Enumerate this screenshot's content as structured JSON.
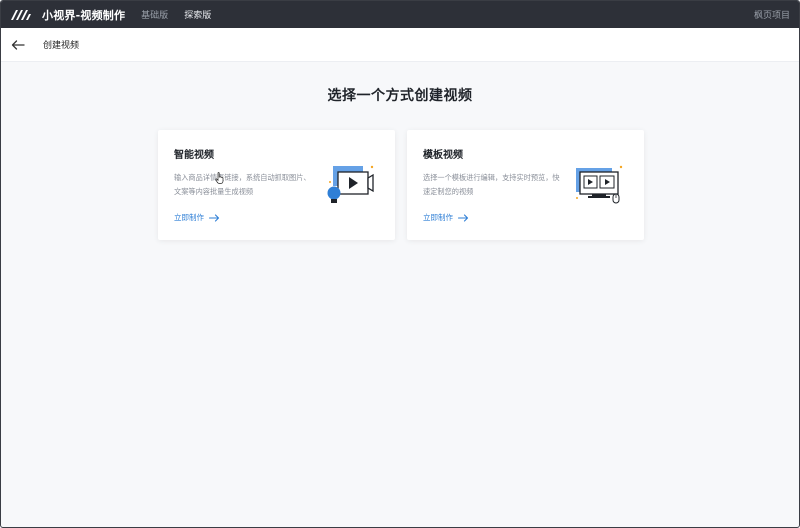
{
  "header": {
    "app_title": "小视界-视频制作",
    "tabs": [
      {
        "label": "基础版"
      },
      {
        "label": "探索版"
      }
    ],
    "right_link": "枫页项目"
  },
  "subheader": {
    "title": "创建视频"
  },
  "main": {
    "heading": "选择一个方式创建视频",
    "cards": [
      {
        "title": "智能视频",
        "description": "输入商品详情页链接，系统自动抓取图片、文案等内容批量生成视频",
        "action": "立即制作",
        "icon": "video-lightbulb-icon"
      },
      {
        "title": "模板视频",
        "description": "选择一个模板进行编辑，支持实时预览，快速定制您的视频",
        "action": "立即制作",
        "icon": "monitor-mouse-icon"
      }
    ]
  },
  "colors": {
    "topbar": "#2d3038",
    "accent": "#2f7fd6",
    "page_bg": "#f7f8fa"
  }
}
